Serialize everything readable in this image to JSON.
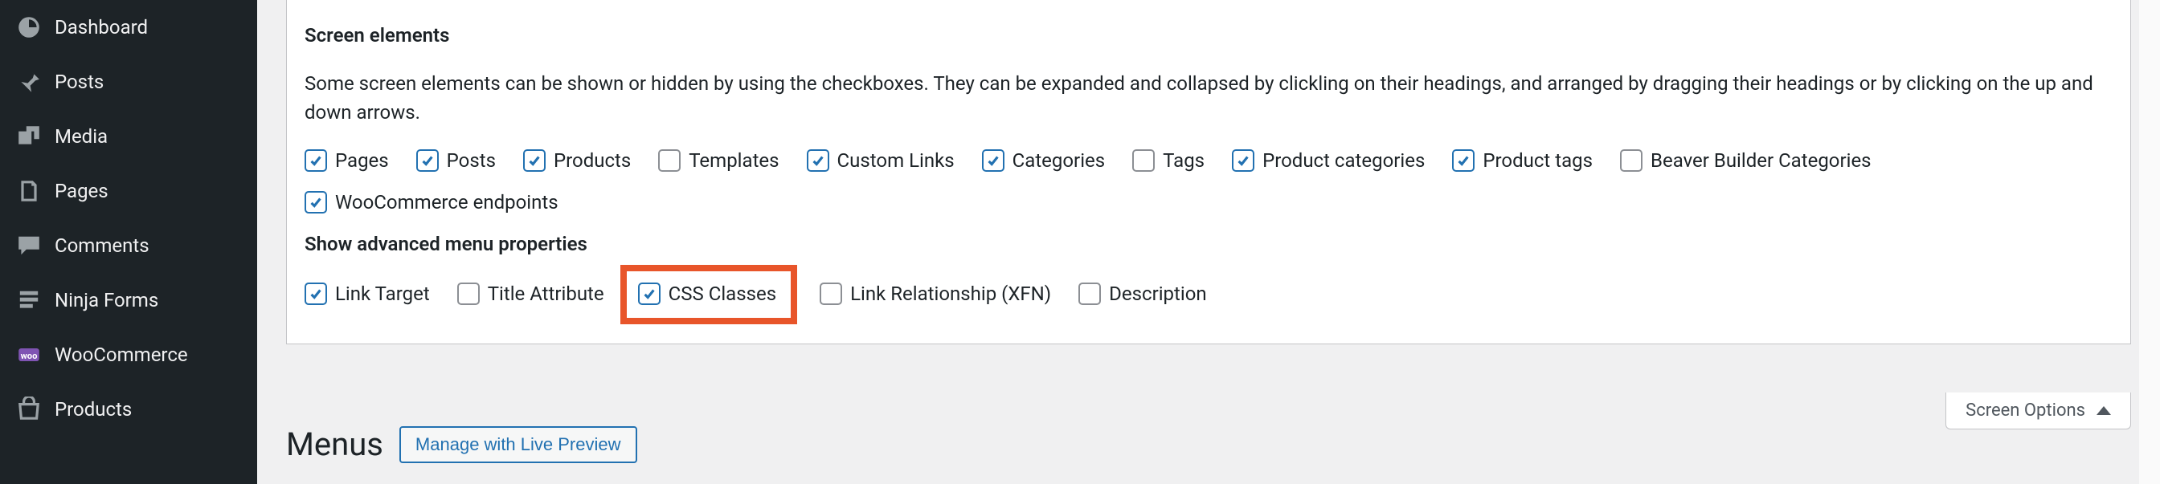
{
  "sidebar": {
    "items": [
      {
        "label": "Dashboard"
      },
      {
        "label": "Posts"
      },
      {
        "label": "Media"
      },
      {
        "label": "Pages"
      },
      {
        "label": "Comments"
      },
      {
        "label": "Ninja Forms"
      },
      {
        "label": "WooCommerce"
      },
      {
        "label": "Products"
      }
    ]
  },
  "panel": {
    "section_title": "Screen elements",
    "description": "Some screen elements can be shown or hidden by using the checkboxes. They can be expanded and collapsed by clickling on their headings, and arranged by dragging their headings or by clicking on the up and down arrows.",
    "row1": [
      {
        "label": "Pages",
        "checked": true
      },
      {
        "label": "Posts",
        "checked": true
      },
      {
        "label": "Products",
        "checked": true
      },
      {
        "label": "Templates",
        "checked": false
      },
      {
        "label": "Custom Links",
        "checked": true
      },
      {
        "label": "Categories",
        "checked": true
      },
      {
        "label": "Tags",
        "checked": false
      },
      {
        "label": "Product categories",
        "checked": true
      },
      {
        "label": "Product tags",
        "checked": true
      },
      {
        "label": "Beaver Builder Categories",
        "checked": false
      }
    ],
    "row2": [
      {
        "label": "WooCommerce endpoints",
        "checked": true
      }
    ],
    "advanced_title": "Show advanced menu properties",
    "row3": [
      {
        "label": "Link Target",
        "checked": true
      },
      {
        "label": "Title Attribute",
        "checked": false
      },
      {
        "label": "CSS Classes",
        "checked": true,
        "highlight": true
      },
      {
        "label": "Link Relationship (XFN)",
        "checked": false
      },
      {
        "label": "Description",
        "checked": false
      }
    ]
  },
  "page": {
    "title": "Menus",
    "preview_button": "Manage with Live Preview",
    "screen_options_label": "Screen Options"
  }
}
